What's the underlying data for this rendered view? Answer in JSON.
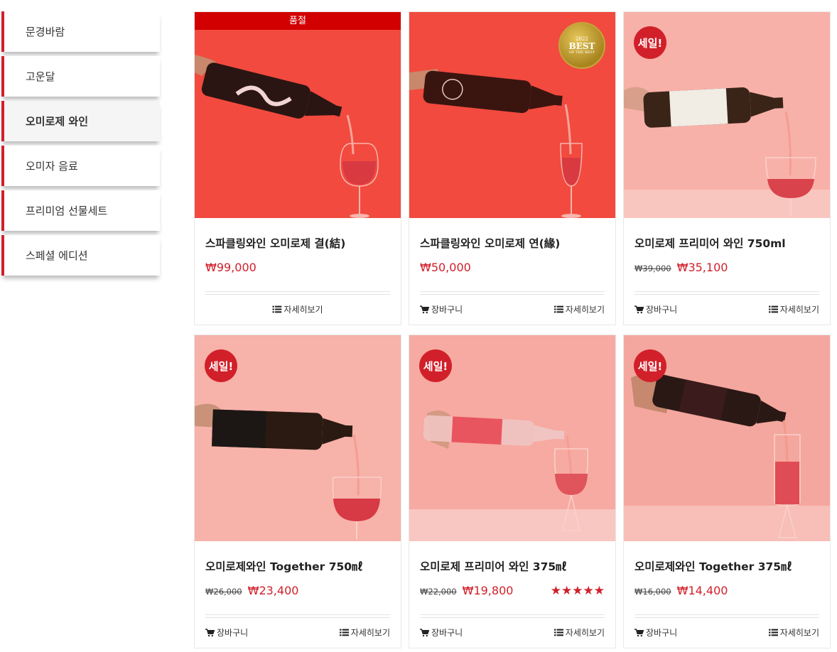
{
  "sidebar": {
    "items": [
      {
        "label": "문경바람",
        "active": false
      },
      {
        "label": "고운달",
        "active": false
      },
      {
        "label": "오미로제 와인",
        "active": true
      },
      {
        "label": "오미자 음료",
        "active": false
      },
      {
        "label": "프리미엄 선물세트",
        "active": false
      },
      {
        "label": "스페셜 에디션",
        "active": false
      }
    ]
  },
  "labels": {
    "cart": "장바구니",
    "detail": "자세히보기",
    "sold_out": "품절",
    "sale": "세일!"
  },
  "medal": {
    "year": "2022",
    "text": "BEST",
    "sub": "OF THE BEST"
  },
  "products": [
    {
      "title": "스파클링와인 오미로제 결(結)",
      "old_price": "",
      "price": "₩99,000",
      "badge": "soldout",
      "icon": "red-sparkling-pour-image"
    },
    {
      "title": "스파클링와인 오미로제 연(緣)",
      "old_price": "",
      "price": "₩50,000",
      "badge": "medal",
      "icon": "red-sparkling-pour-image"
    },
    {
      "title": "오미로제 프리미어 와인 750ml",
      "old_price": "₩39,000",
      "price": "₩35,100",
      "badge": "sale",
      "icon": "premier-pour-image"
    },
    {
      "title": "오미로제와인 Together 750㎖",
      "old_price": "₩26,000",
      "price": "₩23,400",
      "badge": "sale",
      "icon": "together-pour-image"
    },
    {
      "title": "오미로제 프리미어 와인 375㎖",
      "old_price": "₩22,000",
      "price": "₩19,800",
      "badge": "sale",
      "rating": 5,
      "icon": "premier-375-pour-image"
    },
    {
      "title": "오미로제와인 Together 375㎖",
      "old_price": "₩16,000",
      "price": "₩14,400",
      "badge": "sale",
      "icon": "together-375-pour-image"
    }
  ],
  "colors": {
    "accent": "#d1202a",
    "card_bg_red": "#f24a3e",
    "card_bg_pink": "#f6b3ab"
  }
}
